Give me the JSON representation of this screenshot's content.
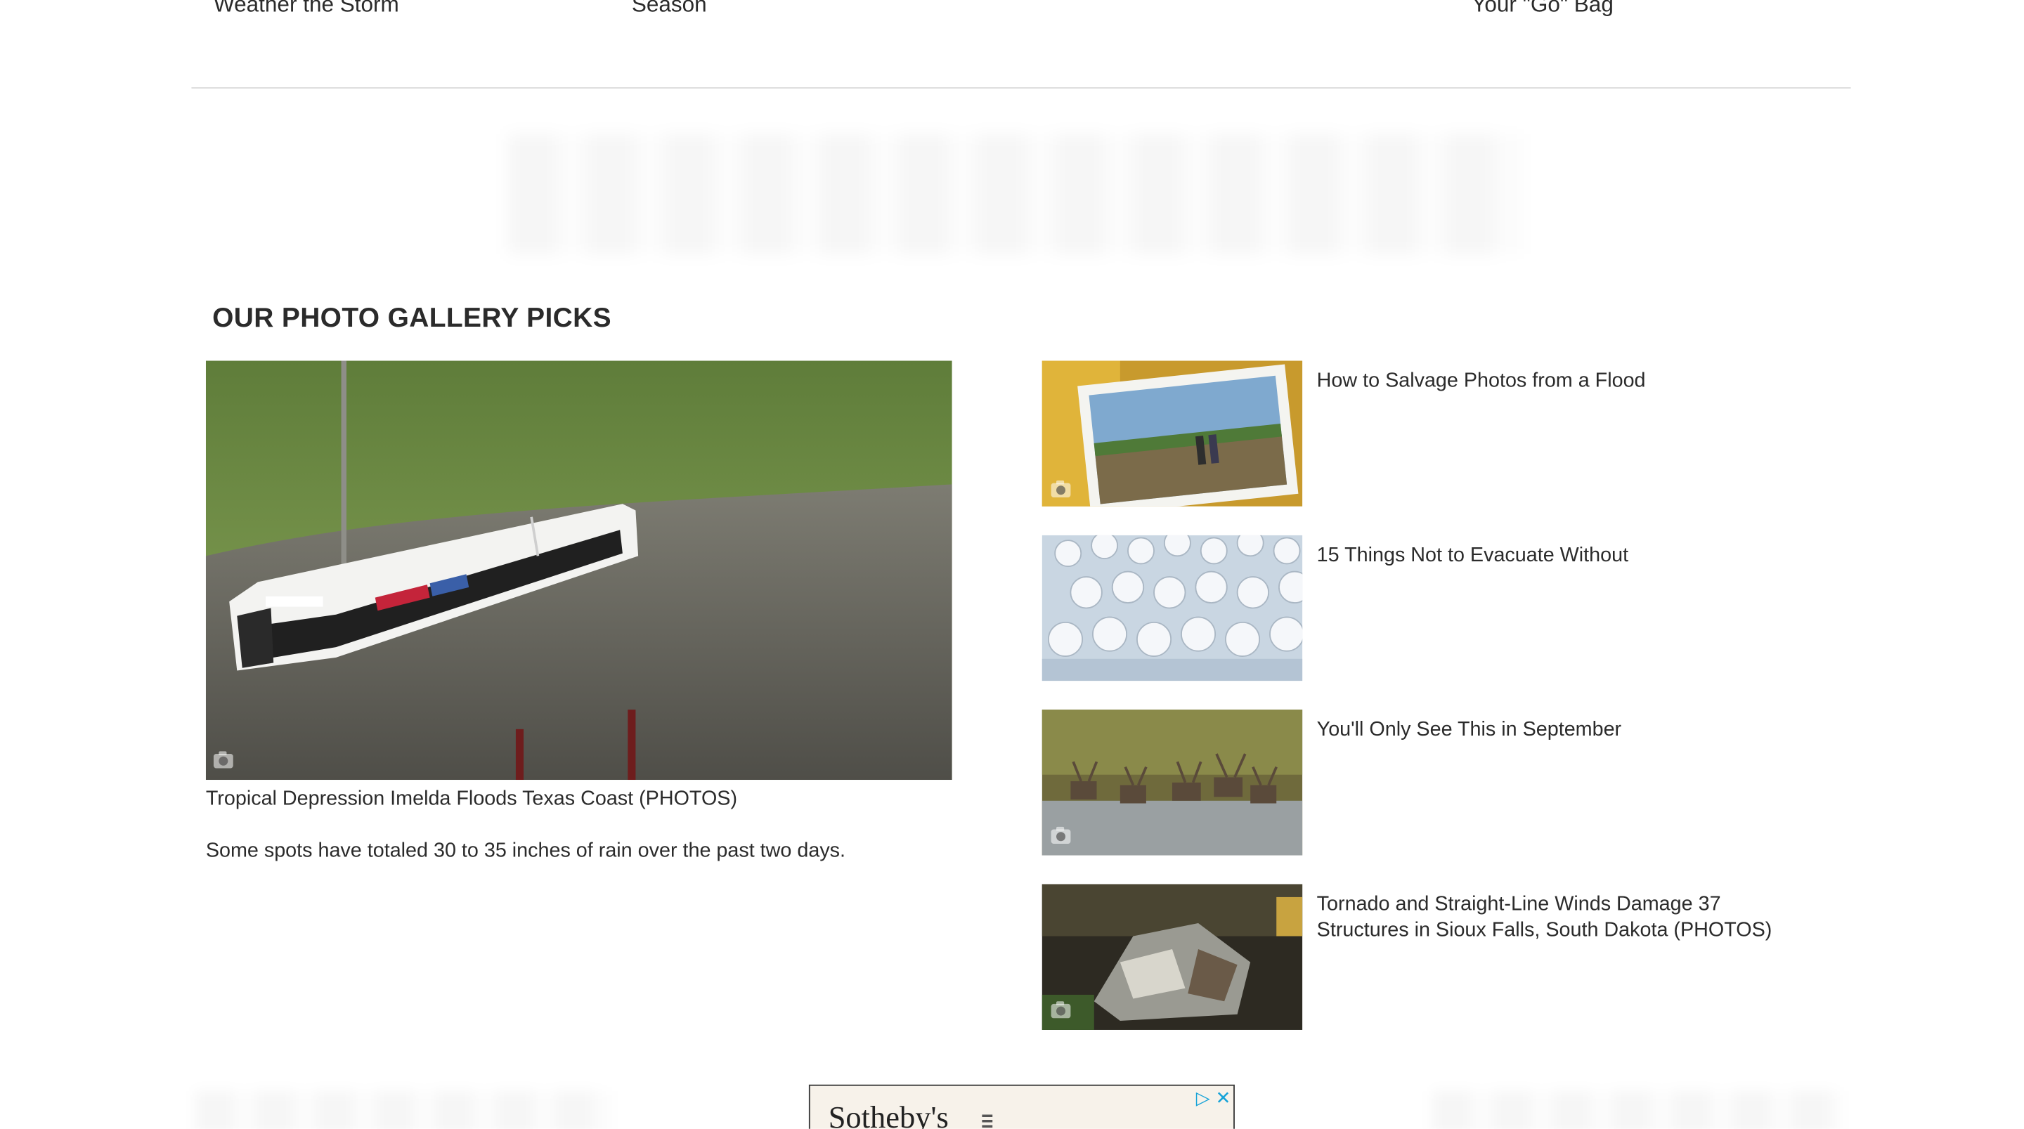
{
  "top_links": [
    {
      "label": "Weather the Storm"
    },
    {
      "label": "Season"
    },
    {
      "label": "Your \"Go\" Bag"
    }
  ],
  "gallery": {
    "heading": "OUR PHOTO GALLERY PICKS",
    "featured": {
      "title": "Tropical Depression Imelda Floods Texas Coast (PHOTOS)",
      "description": "Some spots have totaled 30 to 35 inches of rain over the past two days.",
      "icon": "camera-icon"
    },
    "items": [
      {
        "title": "How to Salvage Photos from a Flood",
        "icon": "camera-icon"
      },
      {
        "title": "15 Things Not to Evacuate Without"
      },
      {
        "title": "You'll Only See This in September",
        "icon": "camera-icon"
      },
      {
        "title": "Tornado and Straight-Line Winds Damage 37 Structures in Sioux Falls, South Dakota (PHOTOS)",
        "icon": "camera-icon"
      }
    ]
  },
  "ad": {
    "brand": "Sotheby's",
    "adchoices_icon": "play-triangle-icon",
    "close_icon": "close-icon",
    "accent": "#16a3d8"
  }
}
